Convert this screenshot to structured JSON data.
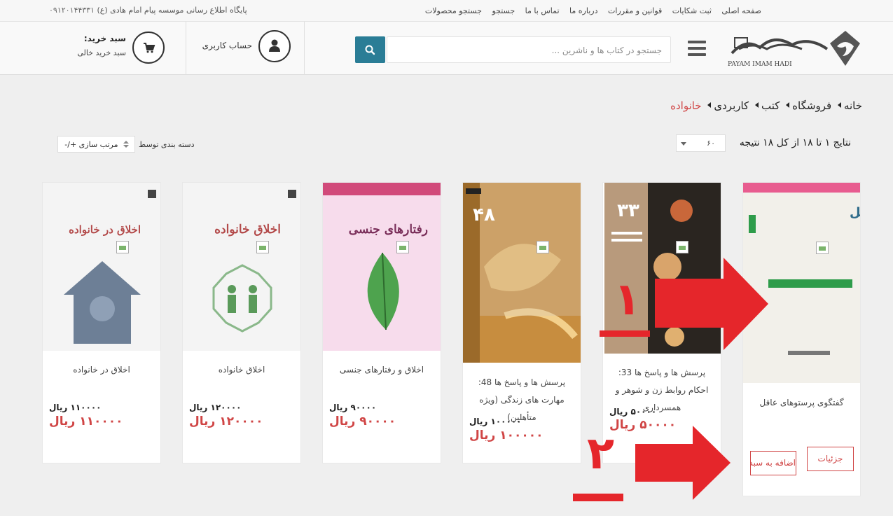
{
  "topbar": {
    "nav": [
      "صفحه اصلی",
      "ثبت شکایات",
      "قوانین و مقررات",
      "درباره ما",
      "تماس با ما",
      "جستجو",
      "جستجو محصولات"
    ],
    "info_text": "پایگاه اطلاع رسانی موسسه پیام امام هادی (ع)",
    "phone": "۰۹۱۲۰۱۴۴۳۳۱"
  },
  "header": {
    "logo_text": "PAYAM IMAM HADI",
    "search_placeholder": "جستجو در کتاب ها و ناشرین ...",
    "account_label": "حساب کاربری",
    "cart_title": "سبد خرید:",
    "cart_status": "سبد خرید خالی"
  },
  "breadcrumb": [
    "خانه",
    "فروشگاه",
    "کتب",
    "کاربردی",
    "خانواده"
  ],
  "results": {
    "text": "نتایج ۱ تا ۱۸ از کل ۱۸ نتیجه",
    "per_page": "۶۰",
    "sort_label": "دسته بندی توسط",
    "sort_value": "مرتب سازی +/-"
  },
  "products": [
    {
      "title": "گفتگوی پرستوهای عاقل",
      "price_old": "",
      "price_new": "",
      "cover_text": "گفتگوی پرستوهای عاقل",
      "details_label": "جزئیات",
      "add_label": "اضافه به سبد"
    },
    {
      "title": "پرسش ها و پاسخ ها 33: احکام روابط زن و شوهر و همسرداری",
      "price_old": "۵۰۰۰۰ ریال",
      "price_new": "۵۰۰۰۰ ریال",
      "cover_text": "۳۳"
    },
    {
      "title": "پرسش ها و پاسخ ها 48: مهارت های زندگی (ویژه متأهلین)",
      "price_old": "۱۰۰۰۰۰ ریال",
      "price_new": "۱۰۰۰۰۰ ریال",
      "cover_text": "۴۸"
    },
    {
      "title": "اخلاق و رفتارهای جنسی",
      "price_old": "۹۰۰۰۰ ریال",
      "price_new": "۹۰۰۰۰ ریال",
      "cover_text": "رفتارهای جنسی"
    },
    {
      "title": "اخلاق خانواده",
      "price_old": "۱۲۰۰۰۰ ریال",
      "price_new": "۱۲۰۰۰۰ ریال",
      "cover_text": "اخلاق خانواده"
    },
    {
      "title": "اخلاق در خانواده",
      "price_old": "۱۱۰۰۰۰ ریال",
      "price_new": "۱۱۰۰۰۰ ریال",
      "cover_text": "اخلاق در خانواده"
    }
  ],
  "annotations": [
    "۱",
    "۲"
  ],
  "colors": {
    "accent": "#2a7d96",
    "price": "#d04545",
    "annotation": "#e5262b"
  }
}
